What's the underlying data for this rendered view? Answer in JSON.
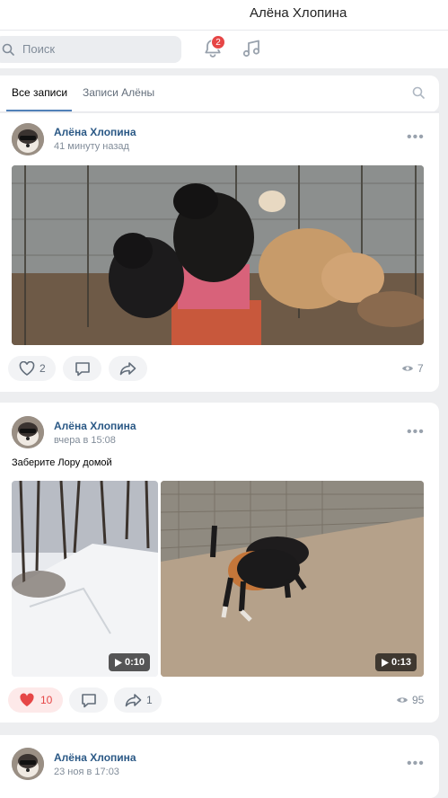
{
  "header": {
    "title": "Алёна Хлопина"
  },
  "search": {
    "placeholder": "Поиск"
  },
  "notifications": {
    "badge": "2"
  },
  "tabs": [
    {
      "label": "Все записи"
    },
    {
      "label": "Записи Алёны"
    }
  ],
  "posts": [
    {
      "author": "Алёна Хлопина",
      "time": "41 минуту назад",
      "text": "",
      "likes": "2",
      "shares": "",
      "views": "7"
    },
    {
      "author": "Алёна Хлопина",
      "time": "вчера в 15:08",
      "text": "Заберите Лору домой",
      "likes": "10",
      "shares": "1",
      "views": "95",
      "videos": [
        {
          "duration": "0:10"
        },
        {
          "duration": "0:13"
        }
      ]
    },
    {
      "author": "Алёна Хлопина",
      "time": "23 ноя в 17:03"
    }
  ],
  "colors": {
    "accent": "#2a5885",
    "liked": "#e64646",
    "tab_underline": "#5181b8"
  }
}
